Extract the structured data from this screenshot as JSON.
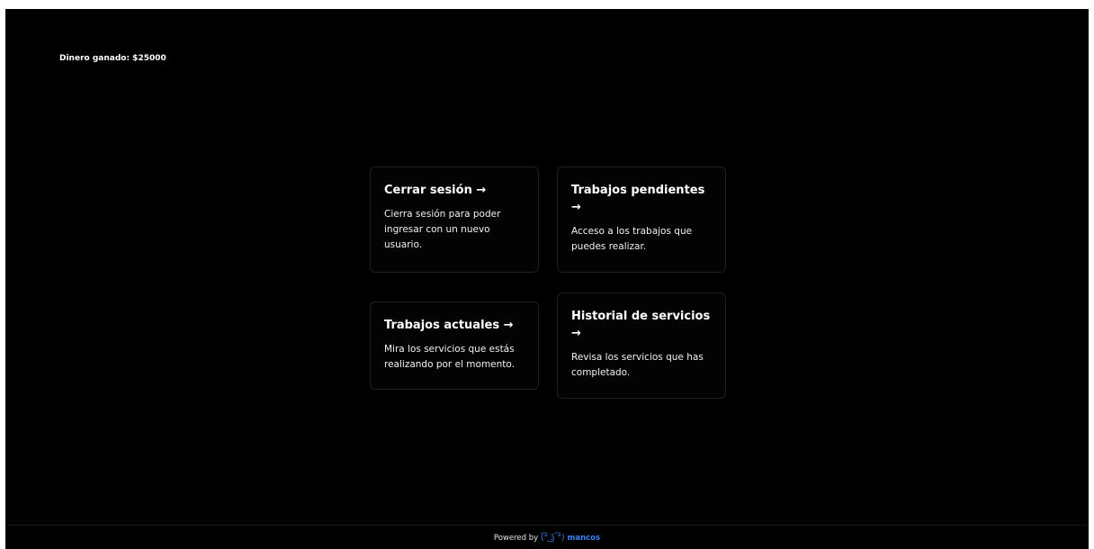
{
  "header": {
    "earnings": "Dinero ganado: $25000"
  },
  "cards": [
    {
      "title": "Cerrar sesión →",
      "description": "Cierra sesión para poder ingresar con un nuevo usuario."
    },
    {
      "title": "Trabajos pendientes →",
      "description": "Acceso a los trabajos que puedes realizar."
    },
    {
      "title": "Trabajos actuales →",
      "description": "Mira los servicios que estás realizando por el momento."
    },
    {
      "title": "Historial de servicios →",
      "description": "Revisa los servicios que has completado."
    }
  ],
  "footer": {
    "powered_by": "Powered by",
    "logo_glyph": "(͡° ͜ʖ ͡°)",
    "brand": "mancos"
  },
  "colors": {
    "background": "#000000",
    "text": "#ffffff",
    "brand_accent": "#3b82f6"
  },
  "icons": {
    "footer_logo": "lenny-face-icon"
  }
}
